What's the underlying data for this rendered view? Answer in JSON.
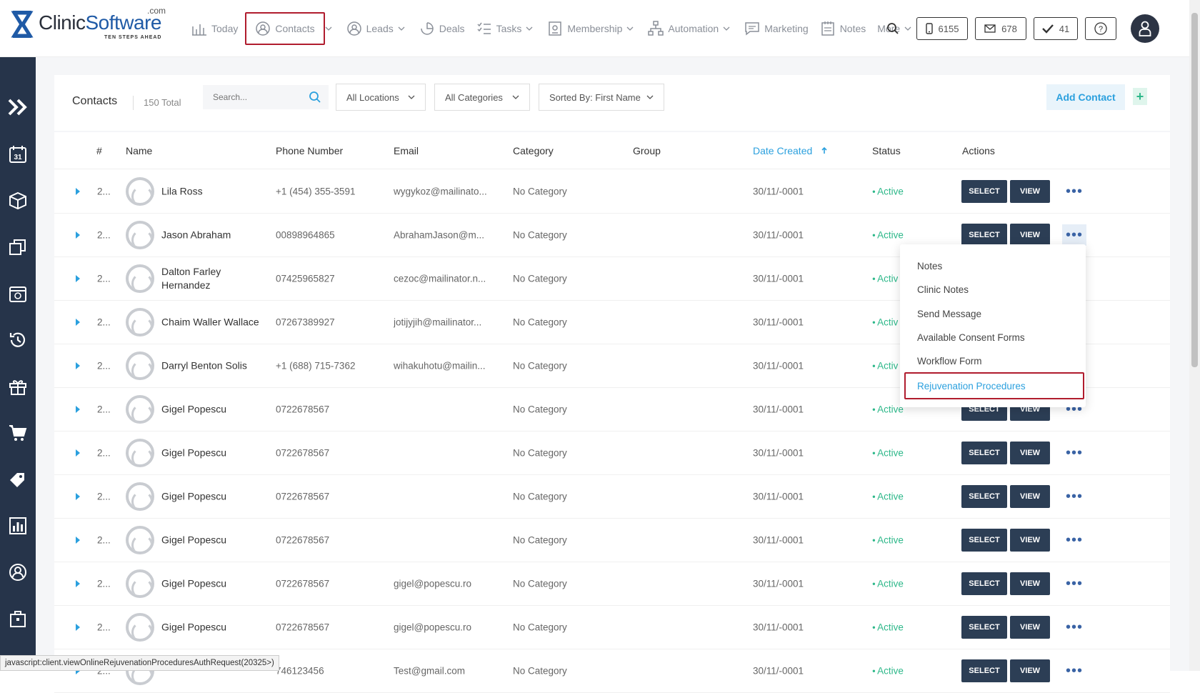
{
  "logo": {
    "word1": "Clinic",
    "word2": "Software",
    "com": ".com",
    "tagline": "TEN STEPS AHEAD"
  },
  "nav": [
    {
      "label": "Today",
      "icon": "chart-bar-icon"
    },
    {
      "label": "Contacts",
      "icon": "contacts-icon",
      "active": true,
      "dropdown": true
    },
    {
      "label": "Leads",
      "icon": "user-circle-icon",
      "dropdown": true
    },
    {
      "label": "Deals",
      "icon": "deals-icon"
    },
    {
      "label": "Tasks",
      "icon": "tasks-icon",
      "dropdown": true
    },
    {
      "label": "Membership",
      "icon": "membership-icon",
      "dropdown": true
    },
    {
      "label": "Automation",
      "icon": "automation-icon",
      "dropdown": true
    },
    {
      "label": "Marketing",
      "icon": "chat-icon"
    },
    {
      "label": "Notes",
      "icon": "notes-icon"
    },
    {
      "label": "More",
      "icon": "",
      "dropdown": true
    }
  ],
  "counters": {
    "sms": "6155",
    "mail": "678",
    "tasks": "41"
  },
  "toolbar": {
    "title": "Contacts",
    "total": "150 Total",
    "search_placeholder": "Search...",
    "location": "All Locations",
    "category": "All Categories",
    "sort": "Sorted By: First Name",
    "add_label": "Add Contact",
    "plus": "+"
  },
  "table": {
    "headers": {
      "num": "#",
      "name": "Name",
      "phone": "Phone Number",
      "email": "Email",
      "category": "Category",
      "group": "Group",
      "date": "Date Created",
      "status": "Status",
      "actions": "Actions"
    },
    "select_label": "SELECT",
    "view_label": "VIEW",
    "more_label": "•••",
    "rows": [
      {
        "num": "2...",
        "name": "Lila Ross",
        "phone": "+1 (454) 355-3591",
        "email": "wygykoz@mailinato...",
        "category": "No Category",
        "date": "30/11/-0001",
        "status": "Active"
      },
      {
        "num": "2...",
        "name": "Jason Abraham",
        "phone": "00898964865",
        "email": "AbrahamJason@m...",
        "category": "No Category",
        "date": "30/11/-0001",
        "status": "Active"
      },
      {
        "num": "2...",
        "name": "Dalton Farley Hernandez",
        "phone": "07425965827",
        "email": "cezoc@mailinator.n...",
        "category": "No Category",
        "date": "30/11/-0001",
        "status": "Activ"
      },
      {
        "num": "2...",
        "name": "Chaim Waller Wallace",
        "phone": "07267389927",
        "email": "jotijyjih@mailinator...",
        "category": "No Category",
        "date": "30/11/-0001",
        "status": "Activ"
      },
      {
        "num": "2...",
        "name": "Darryl Benton Solis",
        "phone": "+1 (688) 715-7362",
        "email": "wihakuhotu@mailin...",
        "category": "No Category",
        "date": "30/11/-0001",
        "status": "Activ"
      },
      {
        "num": "2...",
        "name": "Gigel Popescu",
        "phone": "0722678567",
        "email": "",
        "category": "No Category",
        "date": "30/11/-0001",
        "status": "Active"
      },
      {
        "num": "2...",
        "name": "Gigel Popescu",
        "phone": "0722678567",
        "email": "",
        "category": "No Category",
        "date": "30/11/-0001",
        "status": "Active"
      },
      {
        "num": "2...",
        "name": "Gigel Popescu",
        "phone": "0722678567",
        "email": "",
        "category": "No Category",
        "date": "30/11/-0001",
        "status": "Active"
      },
      {
        "num": "2...",
        "name": "Gigel Popescu",
        "phone": "0722678567",
        "email": "",
        "category": "No Category",
        "date": "30/11/-0001",
        "status": "Active"
      },
      {
        "num": "2...",
        "name": "Gigel Popescu",
        "phone": "0722678567",
        "email": "gigel@popescu.ro",
        "category": "No Category",
        "date": "30/11/-0001",
        "status": "Active"
      },
      {
        "num": "2...",
        "name": "Gigel Popescu",
        "phone": "0722678567",
        "email": "gigel@popescu.ro",
        "category": "No Category",
        "date": "30/11/-0001",
        "status": "Active"
      },
      {
        "num": "2...",
        "name": "",
        "phone": "746123456",
        "email": "Test@gmail.com",
        "category": "No Category",
        "date": "30/11/-0001",
        "status": "Active"
      }
    ]
  },
  "dropdown_menu": [
    "Notes",
    "Clinic Notes",
    "Send Message",
    "Available Consent Forms",
    "Workflow Form",
    "Rejuvenation Procedures"
  ],
  "status_url": "javascript:client.viewOnlineRejuvenationProceduresAuthRequest(20325>)",
  "colors": {
    "sidebar": "#26344a",
    "accent": "#2ba0de",
    "active": "#2eb88a",
    "highlight_border": "#b01c2e",
    "button": "#2c3e55"
  }
}
